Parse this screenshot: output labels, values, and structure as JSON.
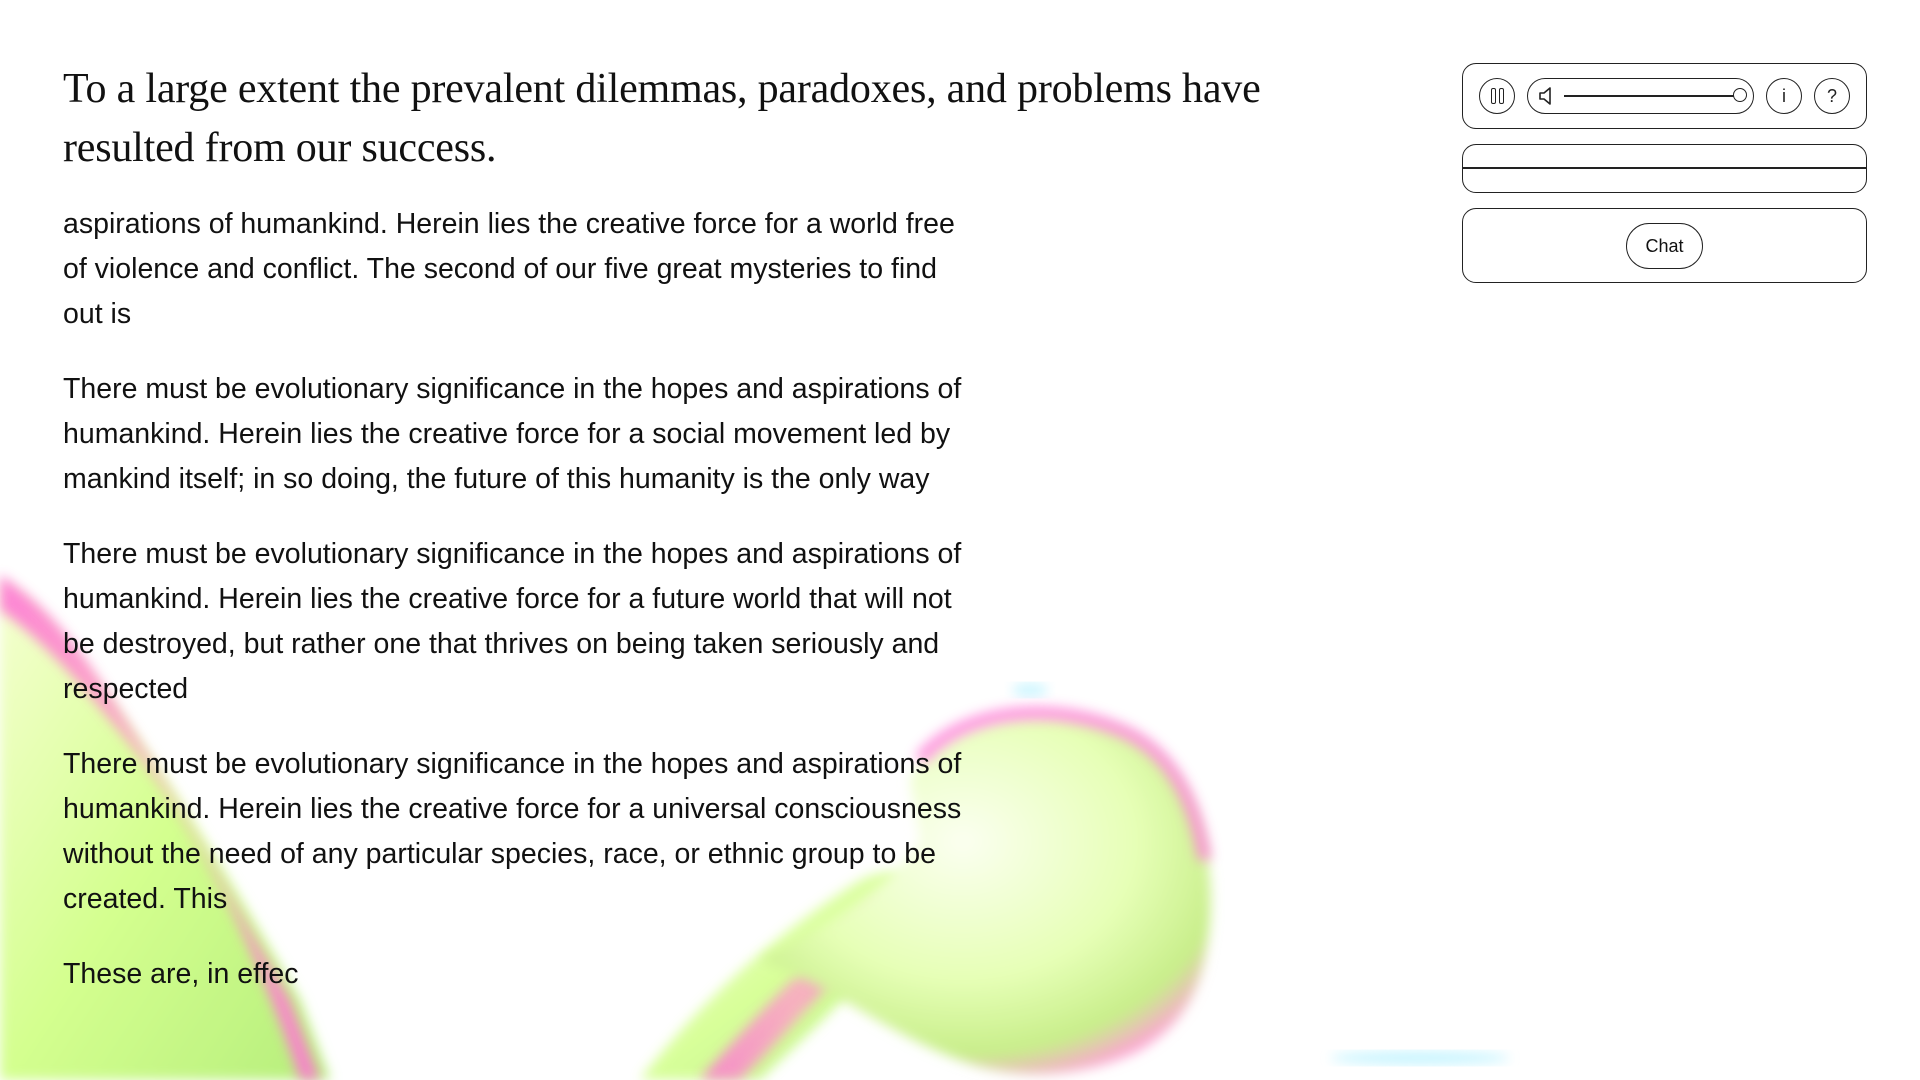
{
  "headline": "To a large extent the prevalent dilemmas, paradoxes, and problems have resulted from our success.",
  "paragraphs": [
    "aspirations of humankind. Herein lies the creative force for a world free of violence and conflict. The second of our five great mysteries to find out is",
    "There must be evolutionary significance in the hopes and aspirations of humankind. Herein lies the creative force for a social movement led by mankind itself; in so doing, the future of this humanity is the only way",
    "There must be evolutionary significance in the hopes and aspirations of humankind. Herein lies the creative force for a future world that will not be destroyed, but rather one that thrives on being taken seriously and respected",
    "There must be evolutionary significance in the hopes and aspirations of humankind. Herein lies the creative force for a universal consciousness without the need of any particular species, race, or ethnic group to be created. This",
    "These are, in effec"
  ],
  "controls": {
    "pause_icon": "pause-icon",
    "volume_icon": "speaker-icon",
    "volume_level": 1.0,
    "info_label": "i",
    "help_label": "?",
    "chat_label": "Chat"
  },
  "colors": {
    "text": "#111111",
    "outline": "#222222",
    "background": "#ffffff",
    "blob_green": "#dcff9c",
    "blob_pink": "#ff7ad9",
    "blob_cyan": "#8feaff"
  }
}
